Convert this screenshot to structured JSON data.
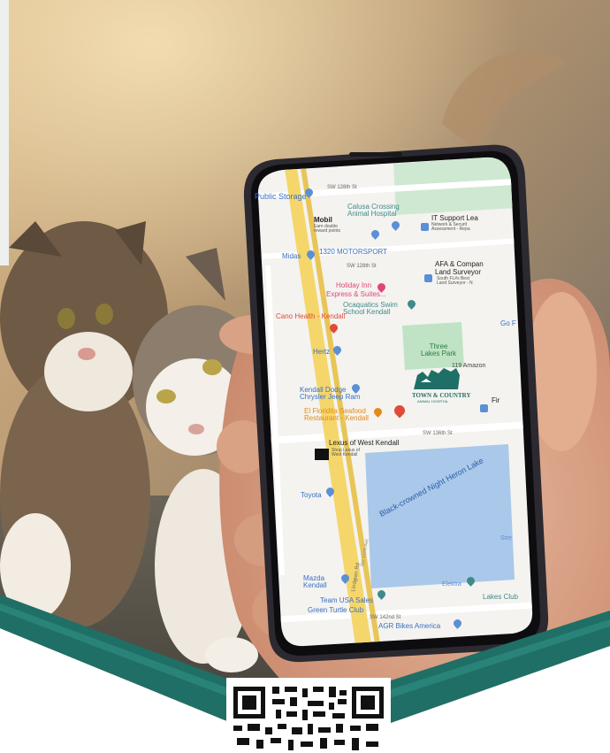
{
  "image": {
    "description_icon": "cats-and-phone-map-photo"
  },
  "map": {
    "labels": {
      "public_storage": "Public Storage",
      "sw128_top": "SW 128th St",
      "mobil": "Mobil",
      "mobil_sub": "Earn double reward points",
      "calusa": "Calusa Crossing\nAnimal Hospital",
      "it_support": "IT Support Lea",
      "it_support_sub": "Network & Securit\nAssessment - Repa",
      "midas": "Midas",
      "motorsport": "1320 MOTORSPORT",
      "sw128_2": "SW 128th St",
      "afa": "AFA & Compan",
      "afa2": "Land Surveyor",
      "afa_sub": "South FL#s Best\nLand Surveyor - N",
      "holiday": "Holiday Inn",
      "holiday2": "Express & Suites...",
      "ocaquatics": "Ocaquatics Swim\nSchool Kendall",
      "cano": "Cano Health - Kendall",
      "go": "Go F",
      "three_lakes": "Three\nLakes Park",
      "hertz": "Hertz",
      "amazon": "119 Amazon",
      "kendall_dodge": "Kendall Dodge\nChrysler Jeep Ram",
      "town_country": "TOWN & COUNTRY",
      "town_country_sub": "ANIMAL HOSPITAL",
      "fir": "Fir",
      "el_floridita": "El Floridita Seafood\nRestaurant - Kendall",
      "sw136": "SW 136th St",
      "lexus": "Lexus of West Kendall",
      "lexus_sub": "Shop Lexus of\nWest Kendall",
      "toyota": "Toyota",
      "heron_lake": "Black-crowned Night Heron Lake",
      "stre": "Stre",
      "mazda": "Mazda\nKendall",
      "lindgren": "Lindgren Rd",
      "sw137": "SW 137th Ave",
      "elektra": "Elektra",
      "team_usa": "Team USA Sales",
      "green_turtle": "Green Turtle Club",
      "lakes_club": "Lakes Club",
      "sw142": "SW 142nd St",
      "agr": "AGR Bikes America"
    }
  },
  "colors": {
    "teal_banner": "#1f6f66",
    "teal_light": "#2f8b80",
    "road_yellow": "#f5d66a",
    "lake_blue": "#a9c8ea",
    "park_green": "#bfe3c4",
    "pin_blue": "#5b8fd6",
    "pin_red": "#e04a3a"
  }
}
